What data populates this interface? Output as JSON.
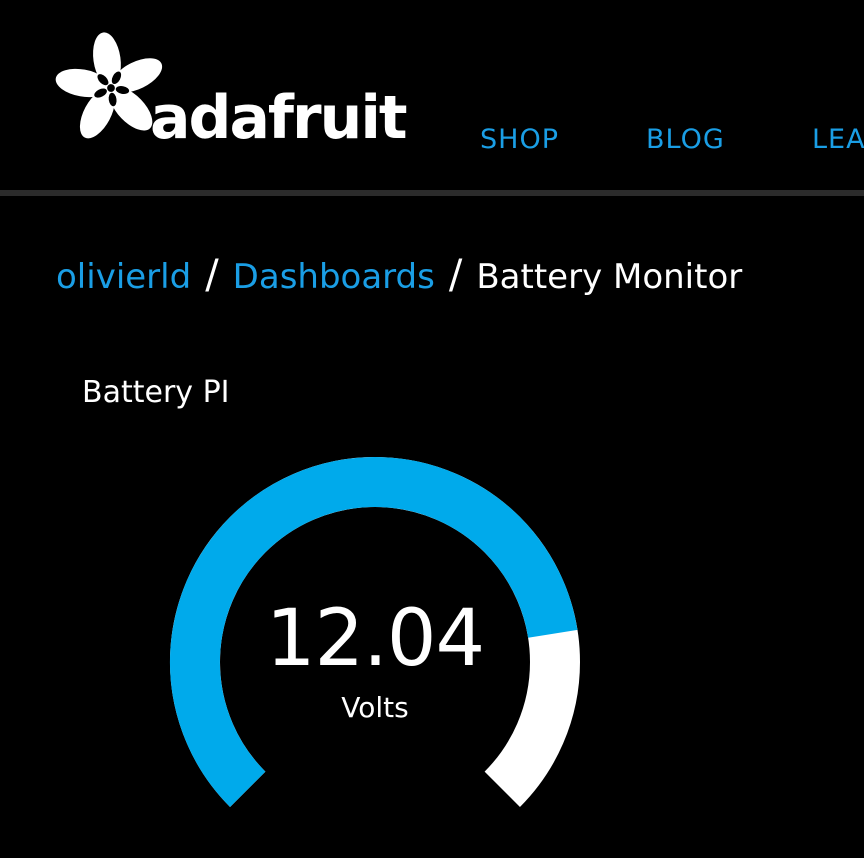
{
  "header": {
    "logo_text": "adafruit",
    "nav": {
      "shop": "SHOP",
      "blog": "BLOG",
      "learn": "LEA"
    }
  },
  "breadcrumb": {
    "user": "olivierld",
    "separator": "/",
    "dashboards": "Dashboards",
    "current": "Battery Monitor"
  },
  "block": {
    "title": "Battery PI",
    "gauge": {
      "value": "12.04",
      "unit": "Volts",
      "fill_fraction": 0.8,
      "fill_color": "#00aaeb",
      "track_color": "#ffffff"
    }
  },
  "colors": {
    "background": "#000000",
    "link": "#1a9ee5",
    "text": "#ffffff"
  }
}
